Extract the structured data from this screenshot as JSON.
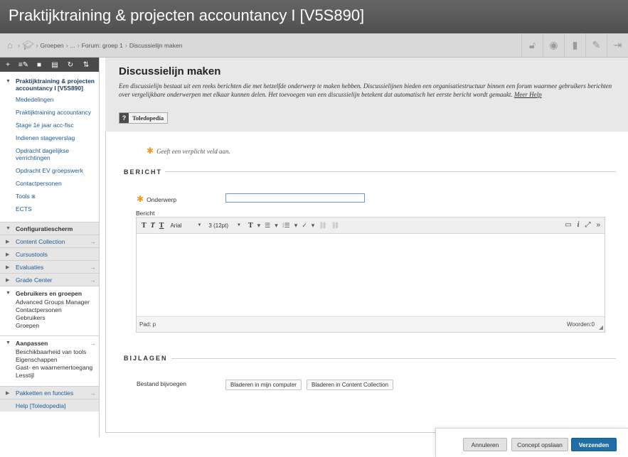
{
  "course_title": "Praktijktraining & projecten accountancy I [V5S890]",
  "breadcrumb": {
    "items": [
      "Groepen",
      "...",
      "Forum: groep 1",
      "Discussielijn maken"
    ]
  },
  "left_nav": {
    "toolbar_icons": [
      "plus-icon",
      "edit-icon",
      "folder-icon",
      "list-icon",
      "refresh-icon",
      "sort-icon"
    ],
    "course_name": "Praktijktraining & projecten accountancy I [V5S890]",
    "links": [
      "Mededelingen",
      "Praktijktraining accountancy",
      "Stage 1e jaar acc-fisc",
      "Indienen stageverslag",
      "Opdracht dagelijkse verrichtingen",
      "Opdracht EV groepswerk",
      "Contactpersonen",
      "Tools ⧆",
      "ECTS"
    ],
    "control_panel": "Configuratiescherm",
    "sections": [
      {
        "label": "Content Collection",
        "arrow": "→"
      },
      {
        "label": "Cursustools",
        "arrow": ""
      },
      {
        "label": "Evaluaties",
        "arrow": "→"
      },
      {
        "label": "Grade Center",
        "arrow": "→"
      }
    ],
    "users_groups": {
      "title": "Gebruikers en groepen",
      "items": [
        "Advanced Groups Manager",
        "Contactpersonen",
        "Gebruikers",
        "Groepen"
      ]
    },
    "customize": {
      "title": "Aanpassen",
      "arrow": "→",
      "items": [
        "Beschikbaarheid van tools",
        "Eigenschappen",
        "Gast- en waarnemertoegang",
        "Lesstijl"
      ]
    },
    "packages": {
      "label": "Pakketten en functies",
      "arrow": "→"
    },
    "help": "Help [Toledopedia]"
  },
  "page": {
    "title": "Discussielijn maken",
    "description": "Een discussielijn bestaat uit een reeks berichten die met hetzelfde onderwerp te maken hebben. Discussielijnen bieden een organisatiestructuur binnen een forum waarmee gebruikers berichten over vergelijkbare onderwerpen met elkaar kunnen delen. Het toevoegen van een discussielijn betekent dat automatisch het eerste bericht wordt gemaakt.",
    "help_link": "Meer Help",
    "toledo_button": "Toledopedia"
  },
  "form": {
    "required_note": "Geeft een verplicht veld aan.",
    "message_section": "BERICHT",
    "subject_label": "Onderwerp",
    "subject_value": "",
    "message_label": "Bericht",
    "font_family": "Arial",
    "font_size": "3 (12pt)",
    "path_label": "Pad: p",
    "word_count": "Woorden:0",
    "attachments_section": "BIJLAGEN",
    "attach_label": "Bestand bijvoegen",
    "browse_computer": "Bladeren in mijn computer",
    "browse_collection": "Bladeren in Content Collection"
  },
  "actions": {
    "cancel": "Annuleren",
    "save_draft": "Concept opslaan",
    "submit": "Verzenden"
  },
  "colors": {
    "header_bg": "#5b5b5b",
    "submit_bg": "#1f6ea5",
    "required_star": "#f39b1d",
    "nav_link": "#1f5b93"
  }
}
